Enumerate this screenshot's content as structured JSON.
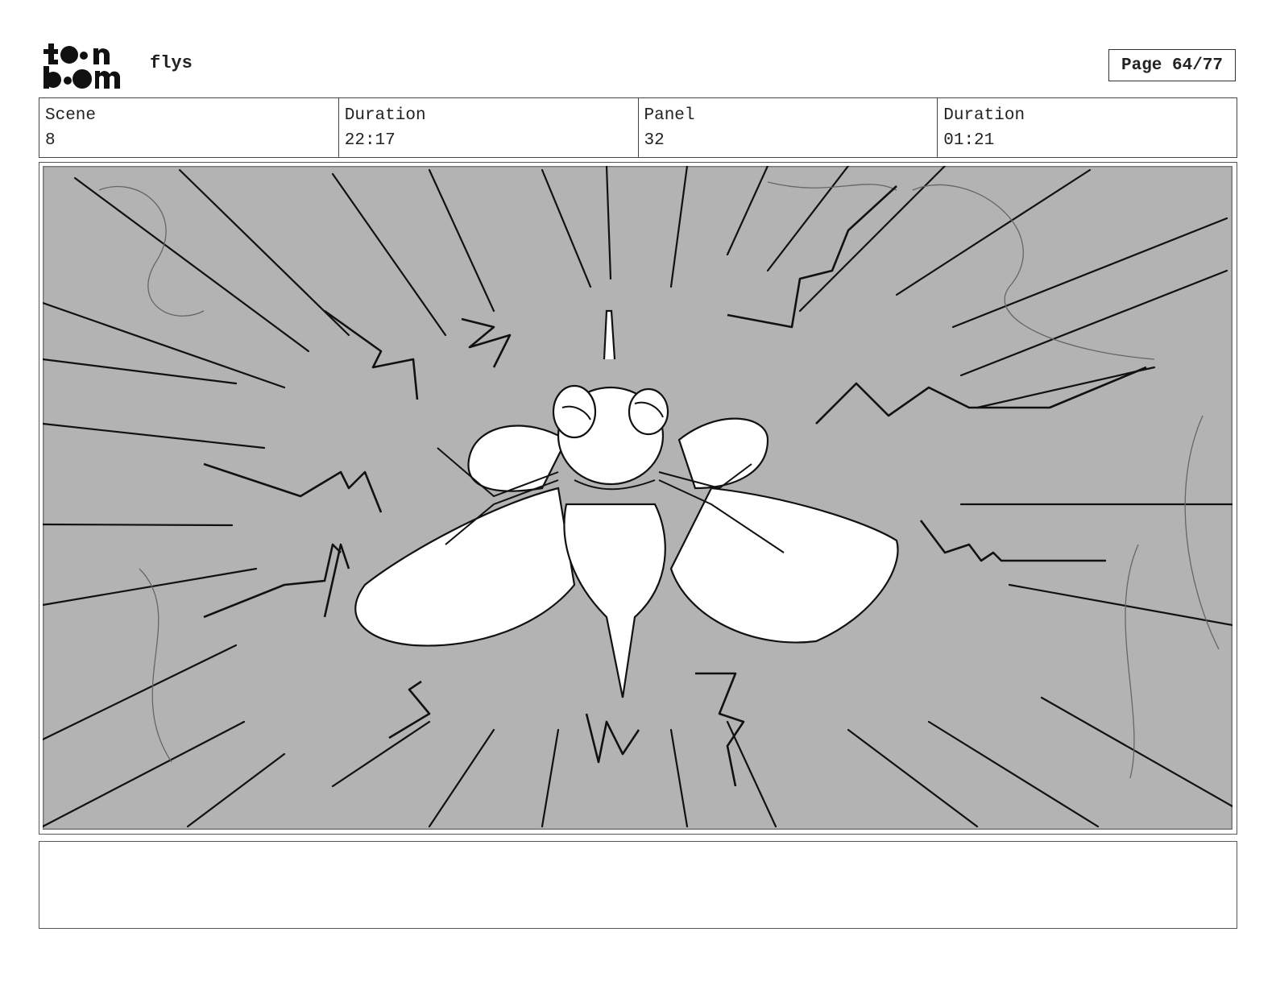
{
  "header": {
    "logo_line1": "t••n",
    "logo_line2": "b••m",
    "project_title": "flys",
    "page_label": "Page 64/77"
  },
  "info": [
    {
      "label": "Scene",
      "value": "8"
    },
    {
      "label": "Duration",
      "value": "22:17"
    },
    {
      "label": "Panel",
      "value": "32"
    },
    {
      "label": "Duration",
      "value": "01:21"
    }
  ],
  "panel": {
    "background_color": "#b3b3b3",
    "line_color": "#111111",
    "subject": "fly-sketch"
  },
  "notes": {
    "text": ""
  }
}
